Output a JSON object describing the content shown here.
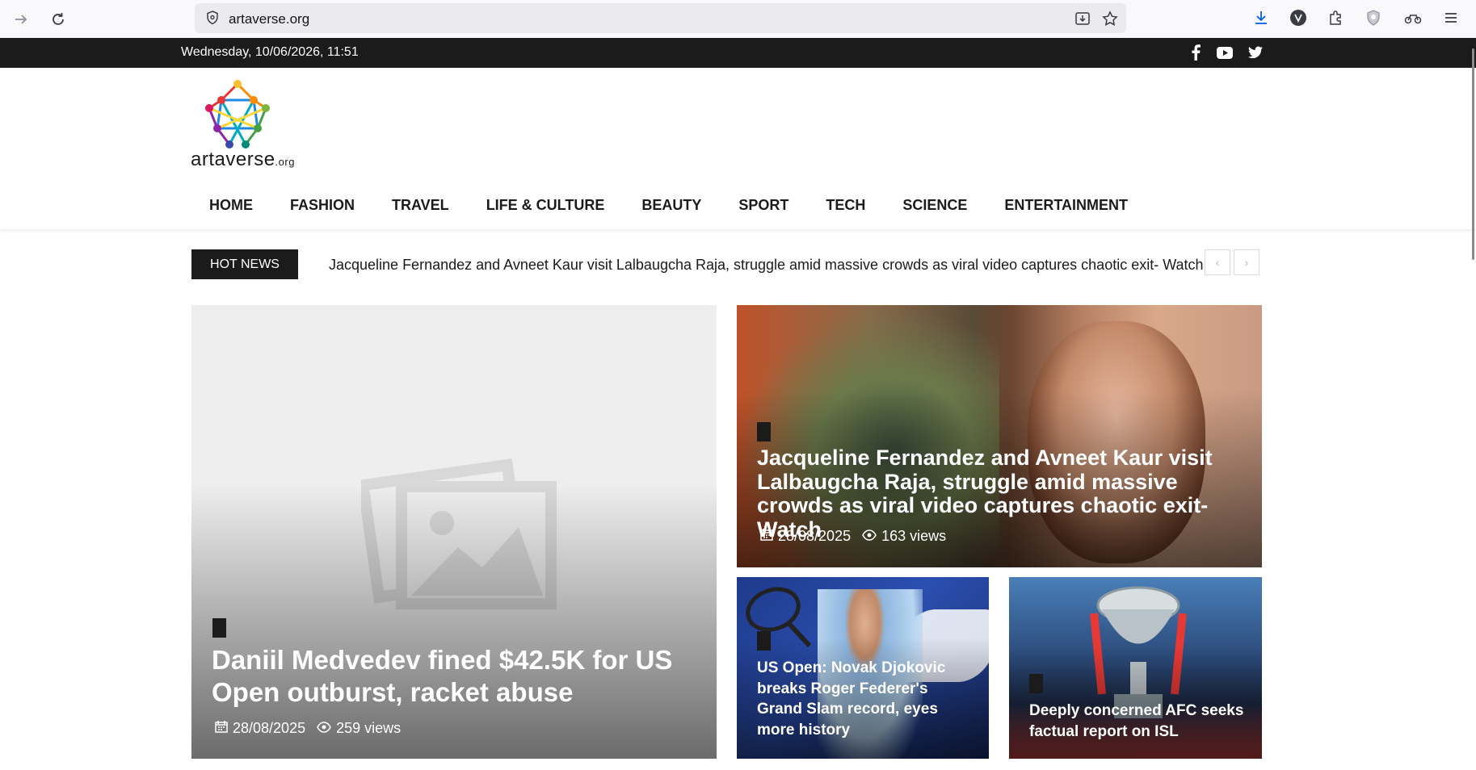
{
  "browser": {
    "url": "artaverse.org"
  },
  "topbar": {
    "datetime": "Wednesday, 10/06/2026, 11:51"
  },
  "header": {
    "logo_text": "artaverse",
    "logo_suffix": ".org",
    "nav": [
      "HOME",
      "FASHION",
      "TRAVEL",
      "LIFE & CULTURE",
      "BEAUTY",
      "SPORT",
      "TECH",
      "SCIENCE",
      "ENTERTAINMENT"
    ]
  },
  "hot_news": {
    "label": "HOT NEWS",
    "headline": "Jacqueline Fernandez and Avneet Kaur visit Lalbaugcha Raja, struggle amid massive crowds as viral video captures chaotic exit- Watch",
    "prev_arrow": "‹",
    "next_arrow": "›"
  },
  "articles": {
    "main": {
      "title": "Daniil Medvedev fined $42.5K for US Open outburst, racket abuse",
      "date": "28/08/2025",
      "views": "259 views"
    },
    "top_right": {
      "title": "Jacqueline Fernandez and Avneet Kaur visit Lalbaugcha Raja, struggle amid massive crowds as viral video captures chaotic exit- Watch",
      "date": "28/08/2025",
      "views": "163 views"
    },
    "bottom_left": {
      "title": "US Open: Novak Djokovic breaks Roger Federer's Grand Slam record, eyes more history"
    },
    "bottom_right": {
      "title": "Deeply concerned AFC seeks factual report on ISL"
    }
  },
  "colors": {
    "dark": "#1b1b1b",
    "placeholder_bg": "#eeeeee"
  }
}
